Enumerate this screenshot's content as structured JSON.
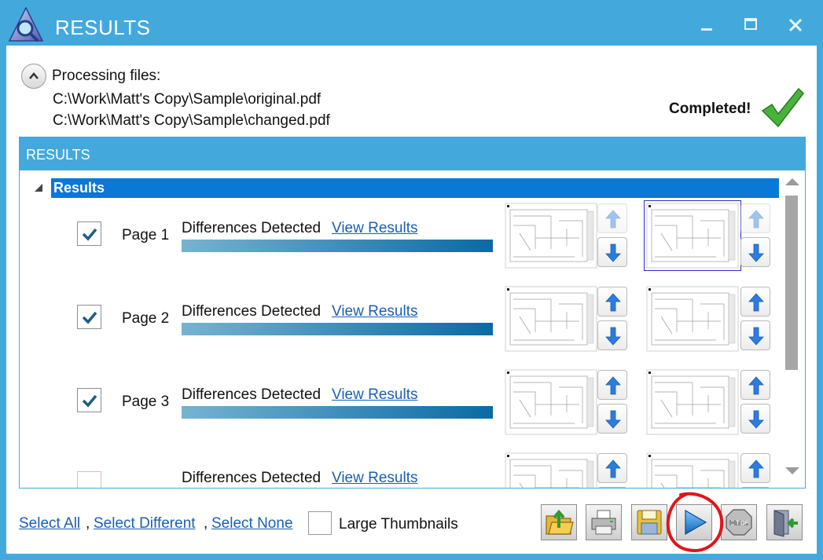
{
  "window": {
    "title": "RESULTS",
    "accent_color": "#43a9dd",
    "controls": [
      "minimize-icon",
      "maximize-icon",
      "close-icon"
    ]
  },
  "processing": {
    "label": "Processing files:",
    "files": [
      "C:\\Work\\Matt's Copy\\Sample\\original.pdf",
      "C:\\Work\\Matt's Copy\\Sample\\changed.pdf"
    ],
    "status": "Completed!",
    "status_icon": "checkmark-icon",
    "status_color": "#3aa832"
  },
  "results": {
    "header": "RESULTS",
    "root_label": "Results",
    "selection_color": "#0a78d7",
    "rows": [
      {
        "page": "Page 1",
        "checked": true,
        "status": "Differences Detected",
        "link": "View Results",
        "selected_thumbnail": "changed",
        "up_a_enabled": false,
        "up_b_enabled": false
      },
      {
        "page": "Page 2",
        "checked": true,
        "status": "Differences Detected",
        "link": "View Results",
        "selected_thumbnail": "none",
        "up_a_enabled": true,
        "up_b_enabled": true
      },
      {
        "page": "Page 3",
        "checked": true,
        "status": "Differences Detected",
        "link": "View Results",
        "selected_thumbnail": "none",
        "up_a_enabled": true,
        "up_b_enabled": true
      },
      {
        "page": "",
        "checked": false,
        "status": "Differences Detected",
        "link": "View Results",
        "selected_thumbnail": "none",
        "up_a_enabled": true,
        "up_b_enabled": true
      }
    ]
  },
  "footer": {
    "select_all": "Select All",
    "select_different": "Select Different",
    "select_none": "Select None",
    "separator": ",",
    "large_thumbnails": "Large Thumbnails",
    "large_thumbnails_checked": false,
    "toolbar": [
      {
        "name": "open-folder-icon"
      },
      {
        "name": "printer-icon"
      },
      {
        "name": "floppy-save-icon"
      },
      {
        "name": "play-icon",
        "highlighted": true
      },
      {
        "name": "stop-sign-icon"
      },
      {
        "name": "exit-door-icon"
      }
    ],
    "highlight_color": "#e0151b"
  }
}
